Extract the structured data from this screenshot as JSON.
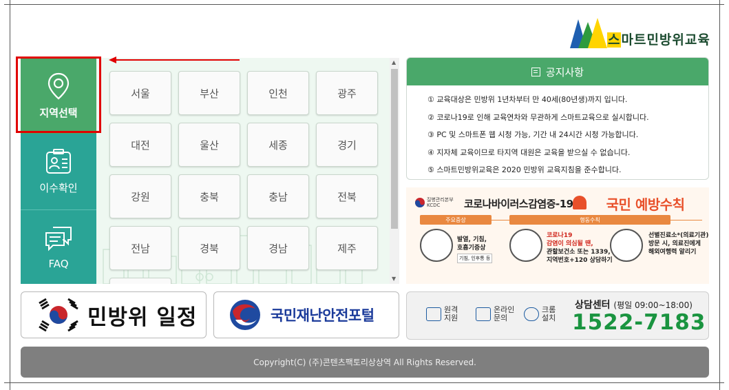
{
  "logo": {
    "first": "스",
    "rest": "마트민방위교육"
  },
  "sidebar": [
    {
      "label": "지역선택"
    },
    {
      "label": "이수확인"
    },
    {
      "label": "FAQ"
    }
  ],
  "regions": [
    "서울",
    "부산",
    "인천",
    "광주",
    "대전",
    "울산",
    "세종",
    "경기",
    "강원",
    "충북",
    "충남",
    "전북",
    "전남",
    "경북",
    "경남",
    "제주"
  ],
  "notice": {
    "title": "공지사항",
    "items": [
      "① 교육대상은 민방위 1년차부터 만 40세(80년생)까지 입니다.",
      "② 코로나19로 인해 교육연차와 무관하게 스마트교육으로 실시합니다.",
      "③ PC 및 스마트폰 웹 시청 가능, 기간 내 24시간 시청 가능합니다.",
      "④ 지자체 교육이므로 타지역 대원은 교육을 받으실 수 없습니다.",
      "⑤ 스마트민방위교육은 2020 민방위 교육지침을 준수합니다."
    ]
  },
  "banner": {
    "org_line1": "질병관리본부",
    "org_line2": "KCDC",
    "title": "코로나바이러스감염증-19",
    "emphasis": "국민 예방수칙",
    "tag_left": "주요증상",
    "tag_right": "행동수칙",
    "sym_line1": "발열, 기침,",
    "sym_line2": "호흡기증상",
    "sym_sub": "기침, 인후통 등",
    "act_line1": "코로나19",
    "act_line2": "감염이 의심될 땐,",
    "act_line3": "관할보건소 또는 1339,",
    "act_line4": "지역번호+120 상담하기",
    "visit_line1": "선별진료소*(의료기관)",
    "visit_line2": "방문 시, 의료진에게",
    "visit_line3": "해외여행력 알리기"
  },
  "schedule_label": "민방위 일정",
  "portal_label": "국민재난안전포털",
  "counsel": {
    "remote_1": "원격",
    "remote_2": "지원",
    "online_1": "온라인",
    "online_2": "문의",
    "chrome_1": "크롬",
    "chrome_2": "설치",
    "center": "상담센터",
    "hours": "(평일 09:00~18:00)",
    "phone": "1522-7183"
  },
  "footer": "Copyright(C) (주)콘텐츠팩토리상상역   All Rights Reserved."
}
